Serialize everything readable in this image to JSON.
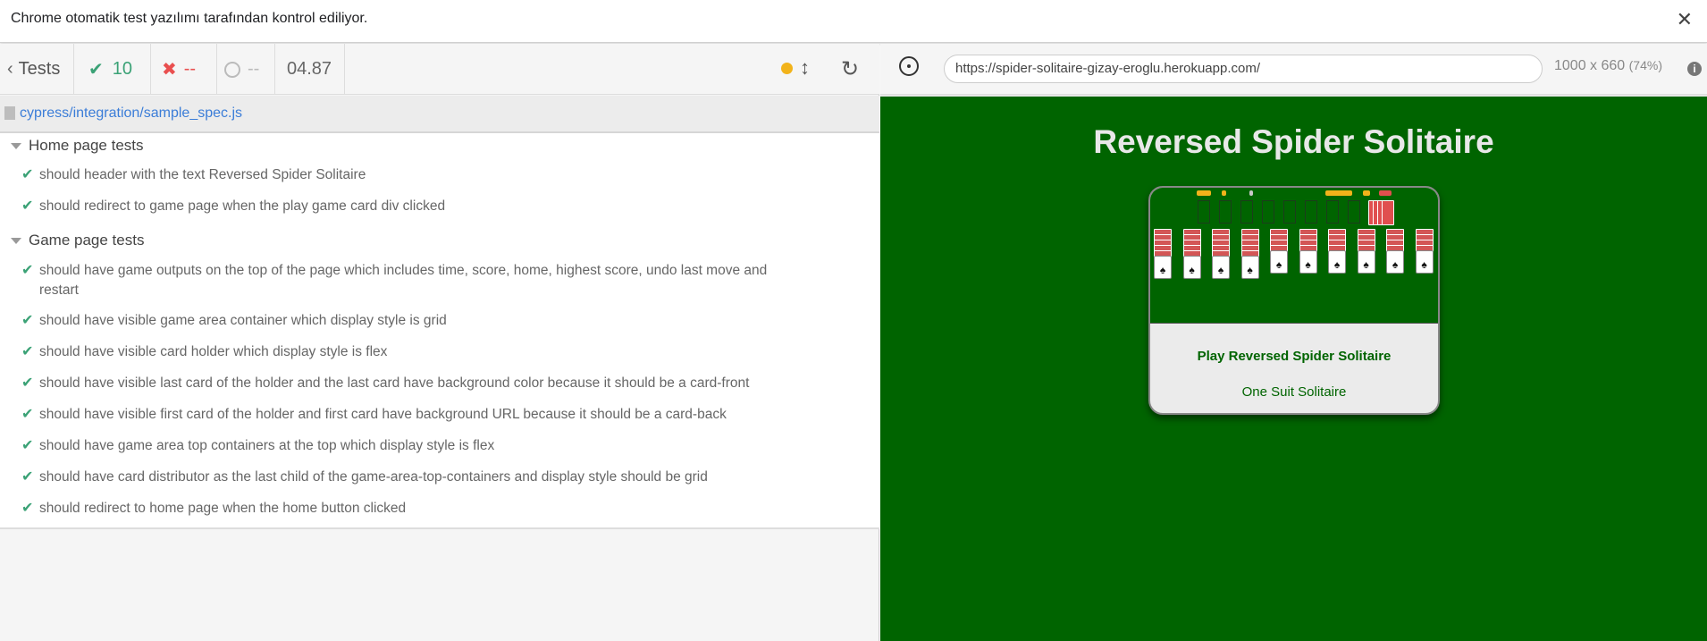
{
  "infobar": {
    "message": "Chrome otomatik test yazılımı tarafından kontrol ediliyor.",
    "close_glyph": "✕"
  },
  "reporter": {
    "tests_label": "Tests",
    "passed_count": "10",
    "failed_count": "--",
    "pending_count": "--",
    "duration": "04.87",
    "status_color": "#f2b31a",
    "spec_path": "cypress/integration/sample_spec.js",
    "suites": [
      {
        "title": "Home page tests",
        "tests": [
          "should header with the text Reversed Spider Solitaire",
          "should redirect to game page when the play game card div clicked"
        ]
      },
      {
        "title": "Game page tests",
        "tests": [
          "should have game outputs on the top of the page which includes time, score, home, highest score, undo last move and restart",
          "should have visible game area container which display style is grid",
          "should have visible card holder which display style is flex",
          "should have visible last card of the holder and the last card have background color because it should be a card-front",
          "should have visible first card of the holder and first card have background URL because it should be a card-back",
          "should have game area top containers at the top which display style is flex",
          "should have card distributor as the last child of the game-area-top-containers and display style should be grid",
          "should redirect to home page when the home button clicked"
        ]
      }
    ]
  },
  "aut": {
    "url": "https://spider-solitaire-gizay-eroglu.herokuapp.com/",
    "viewport_size": "1000 x 660",
    "viewport_scale": "(74%)",
    "info_glyph": "i",
    "app_title": "Reversed Spider Solitaire",
    "play_label": "Play Reversed Spider Solitaire",
    "suit_label": "One Suit Solitaire",
    "background_color": "#006400",
    "column_suit_glyph": "♠"
  }
}
